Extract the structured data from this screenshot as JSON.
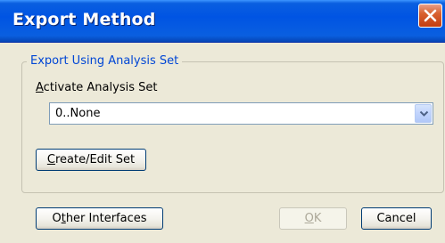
{
  "window": {
    "title": "Export Method",
    "close_icon": "close-x-icon",
    "colors": {
      "titlebar": "#0054e3",
      "close_button": "#d9612f",
      "dialog_background": "#ece9d8",
      "group_legend": "#0046d5",
      "button_border": "#003c74"
    }
  },
  "group": {
    "legend": "Export Using Analysis Set",
    "field_label_mnemonic": "A",
    "field_label_rest": "ctivate Analysis Set",
    "select": {
      "value": "0..None",
      "arrow_icon": "chevron-down-icon"
    },
    "create_edit_mnemonic": "C",
    "create_edit_rest": "reate/Edit Set"
  },
  "footer": {
    "other_interfaces_prefix": "O",
    "other_interfaces_mnemonic": "t",
    "other_interfaces_rest": "her Interfaces",
    "ok_mnemonic": "O",
    "ok_rest": "K",
    "ok_enabled": false,
    "cancel_label": "Cancel"
  }
}
